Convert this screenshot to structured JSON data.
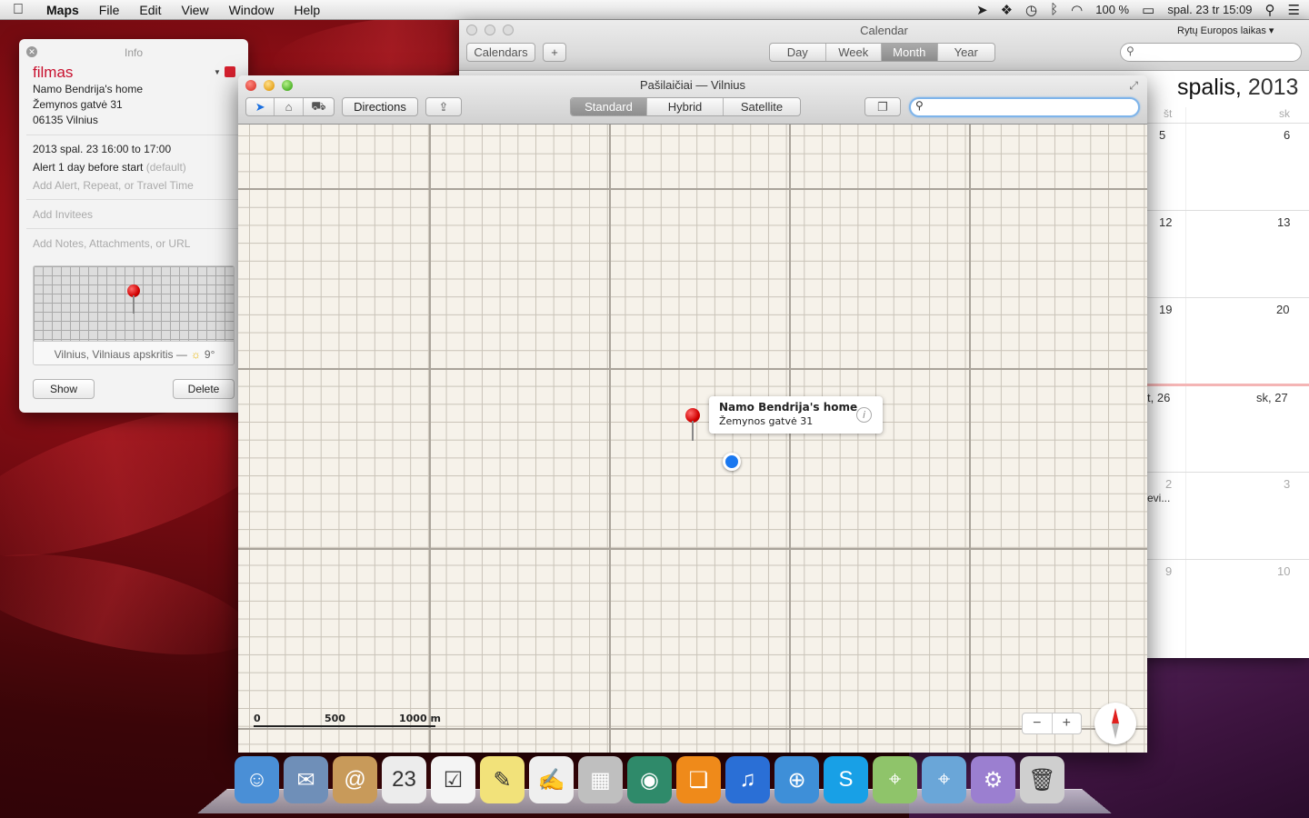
{
  "menubar": {
    "app": "Maps",
    "items": [
      "File",
      "Edit",
      "View",
      "Window",
      "Help"
    ],
    "battery": "100 %",
    "datetime": "spal. 23 tr  15:09"
  },
  "info": {
    "header": "Info",
    "title": "filmas",
    "address": [
      "Namo Bendrija's home",
      "Žemynos gatvė 31",
      "06135 Vilnius"
    ],
    "when": "2013 spal. 23  16:00 to 17:00",
    "alert": "Alert 1 day before start",
    "alert_default": "(default)",
    "add_alert": "Add Alert, Repeat, or Travel Time",
    "add_invitees": "Add Invitees",
    "add_notes": "Add Notes, Attachments, or URL",
    "map_caption": "Vilnius, Vilniaus apskritis —",
    "temperature": "9°",
    "show_btn": "Show",
    "delete_btn": "Delete",
    "calendar_color": "#d6202e"
  },
  "calendar": {
    "title": "Calendar",
    "timezone": "Rytų Europos laikas ▾",
    "calendars_btn": "Calendars",
    "add_btn": "+",
    "views": [
      "Day",
      "Week",
      "Month",
      "Year"
    ],
    "selected_view": "Month",
    "month_name": "spalis,",
    "year": "2013",
    "day_headers": [
      "št",
      "sk"
    ],
    "days": [
      [
        "5",
        "6"
      ],
      [
        "12",
        "13"
      ],
      [
        "19",
        "20"
      ],
      [
        "t, 26",
        "sk, 27"
      ],
      [
        "2",
        "3"
      ],
      [
        "9",
        "10"
      ]
    ],
    "event_fragment": "evi..."
  },
  "maps": {
    "title": "Pašilaičiai — Vilnius",
    "directions_btn": "Directions",
    "modes": [
      "Standard",
      "Hybrid",
      "Satellite"
    ],
    "selected_mode": "Standard",
    "callout_title": "Namo Bendrija's home",
    "callout_subtitle": "Žemynos gatvė 31",
    "scale_labels": [
      "0",
      "500",
      "1000 m"
    ],
    "zoom_out": "−",
    "zoom_in": "+"
  },
  "dock": {
    "apps": [
      {
        "name": "finder-icon",
        "glyph": "☺",
        "color": "#4a8fd6"
      },
      {
        "name": "mail-stamp-icon",
        "glyph": "✉",
        "color": "#6f8fb8"
      },
      {
        "name": "contacts-icon",
        "glyph": "@",
        "color": "#c89a5a"
      },
      {
        "name": "calendar-icon",
        "glyph": "23",
        "color": "#ececec"
      },
      {
        "name": "reminders-icon",
        "glyph": "☑",
        "color": "#f4f4f4"
      },
      {
        "name": "stickies-icon",
        "glyph": "✎",
        "color": "#f2e27a"
      },
      {
        "name": "textedit-icon",
        "glyph": "✍",
        "color": "#efefef"
      },
      {
        "name": "calculator-icon",
        "glyph": "▦",
        "color": "#bfbfbf"
      },
      {
        "name": "photo-booth-icon",
        "glyph": "◉",
        "color": "#2f8a6a"
      },
      {
        "name": "ibooks-icon",
        "glyph": "❏",
        "color": "#ef8a1a"
      },
      {
        "name": "itunes-icon",
        "glyph": "♫",
        "color": "#2a6fd6"
      },
      {
        "name": "safari-icon",
        "glyph": "⊕",
        "color": "#3e8fd8"
      },
      {
        "name": "skype-icon",
        "glyph": "S",
        "color": "#18a0e6"
      },
      {
        "name": "maps-icon",
        "glyph": "⌖",
        "color": "#8fc46a"
      },
      {
        "name": "preview-icon",
        "glyph": "⌖",
        "color": "#6aa6d8"
      },
      {
        "name": "applications-folder-icon",
        "glyph": "⚙",
        "color": "#9b7fd0"
      },
      {
        "name": "trash-icon",
        "glyph": "🗑",
        "color": "#cfcfcf"
      }
    ]
  }
}
